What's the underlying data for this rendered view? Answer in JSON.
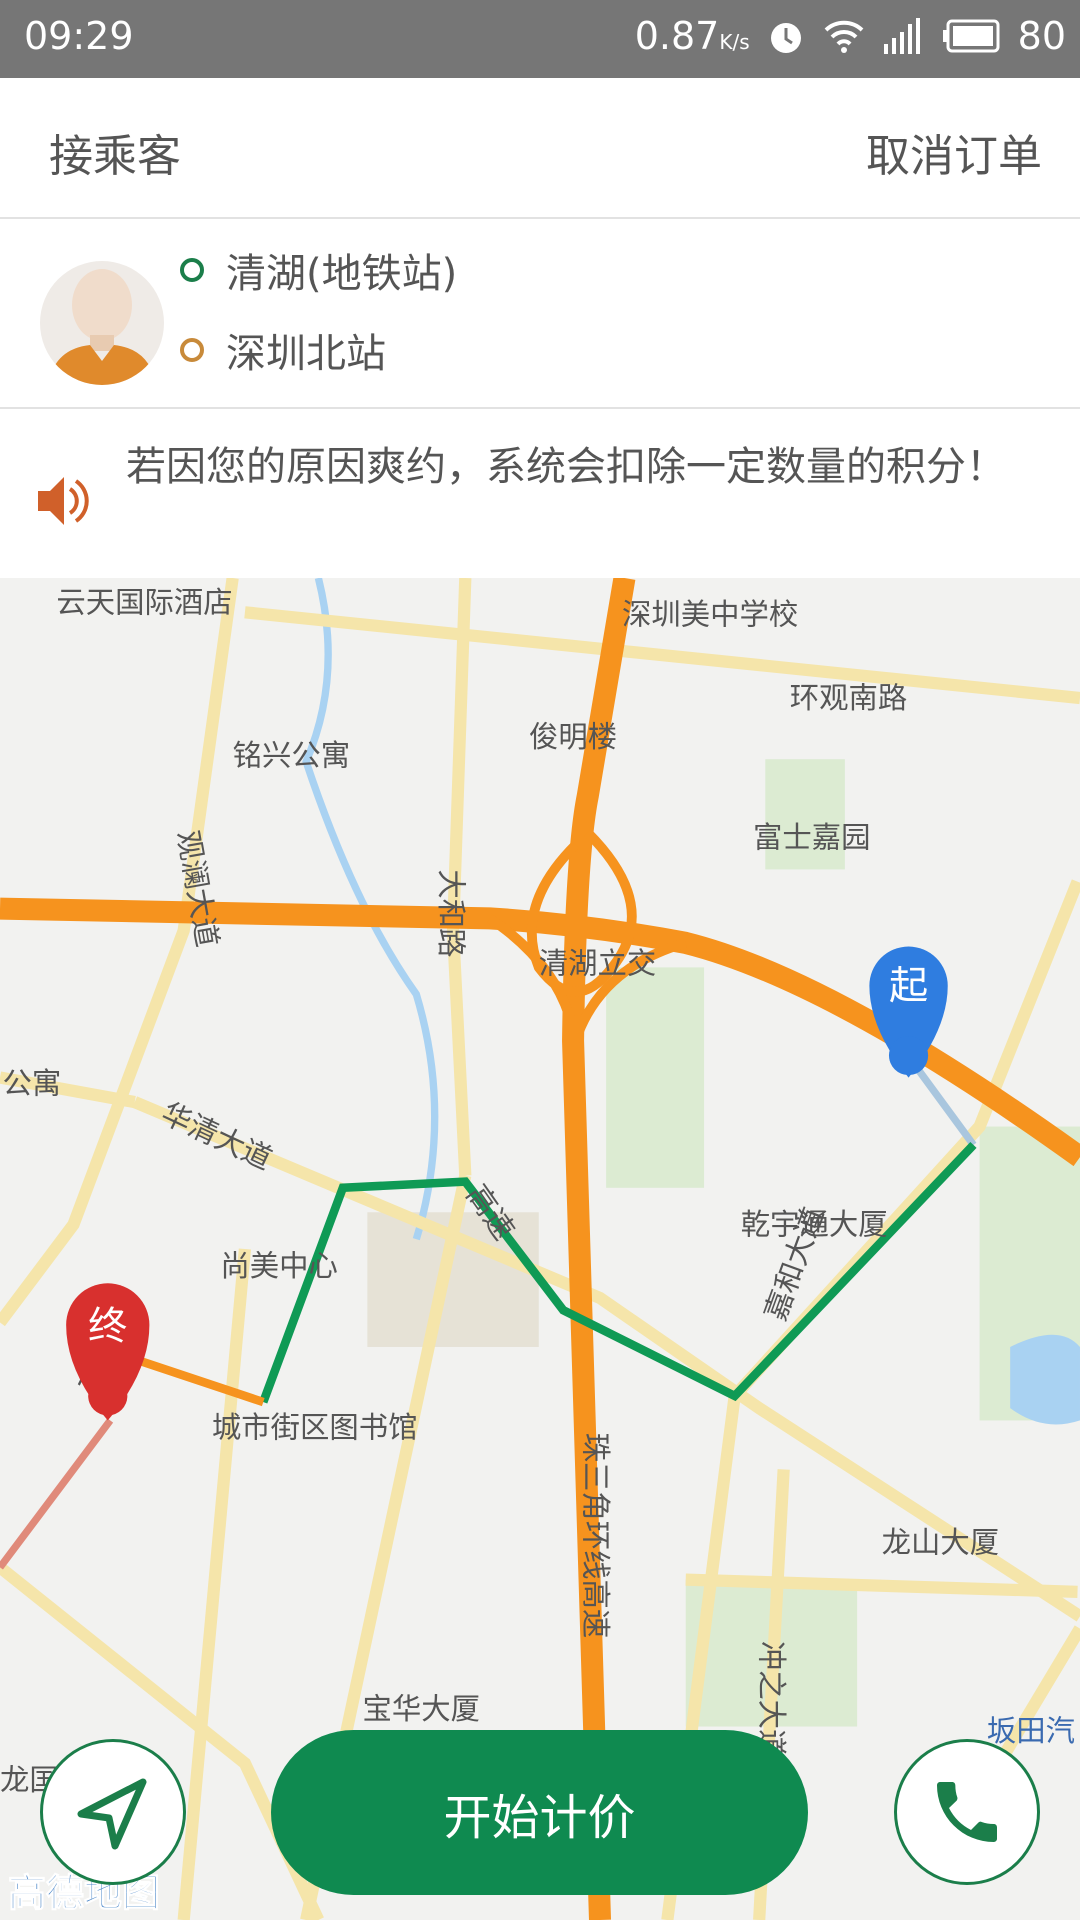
{
  "status_bar": {
    "time": "09:29",
    "net_speed": "0.87",
    "net_unit": "K/s",
    "battery": "80",
    "icons": [
      "alarm-icon",
      "wifi-icon",
      "signal-4g-icon",
      "battery-icon"
    ]
  },
  "header": {
    "title": "接乘客",
    "cancel_label": "取消订单"
  },
  "trip": {
    "origin": "清湖(地铁站)",
    "destination": "深圳北站",
    "origin_color": "#1b7e4a",
    "destination_color": "#c88a3a"
  },
  "notice": {
    "text": "若因您的原因爽约，系统会扣除一定数量的积分！",
    "icon": "speaker-icon"
  },
  "map": {
    "labels": [
      "云天国际酒店",
      "深圳美中学校",
      "环观南路",
      "铭兴公寓",
      "俊明楼",
      "富士嘉园",
      "观澜大道",
      "大和路",
      "清湖立交",
      "公寓",
      "华清大道",
      "乾宇通大厦",
      "尚美中心",
      "清湖",
      "城市街区图书馆",
      "龙山大厦",
      "珠三角环线高速",
      "宝华大厦",
      "冲之大道",
      "坂田汽",
      "龙国",
      "嘉和大道",
      "高速"
    ],
    "start_marker": "起",
    "end_marker": "终",
    "logo": "高德地图",
    "route_color": "#0f9a55",
    "highway_color": "#f6931e"
  },
  "actions": {
    "start_label": "开始计价",
    "locate_icon": "navigation-arrow-icon",
    "phone_icon": "phone-icon",
    "accent": "#0f8a50"
  }
}
